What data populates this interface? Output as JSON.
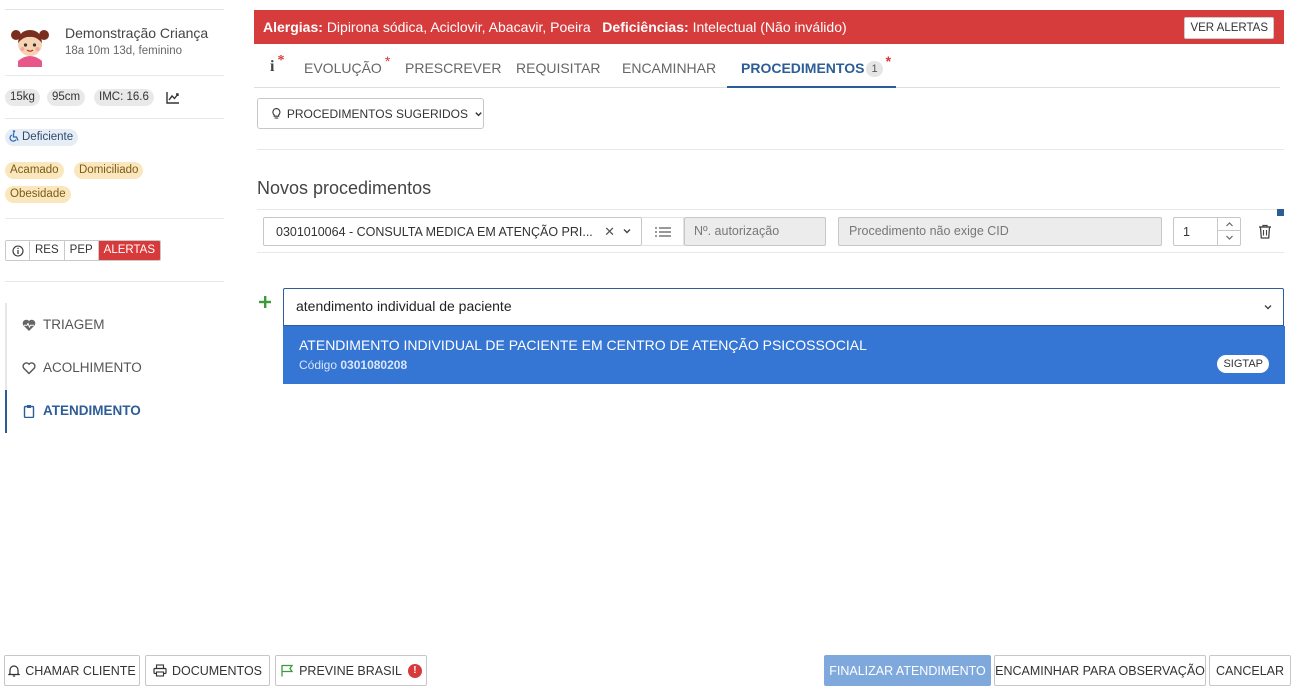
{
  "patient": {
    "name": "Demonstração Criança",
    "info": "18a 10m 13d, feminino"
  },
  "measures": {
    "weight": "15kg",
    "height": "95cm",
    "imc": "IMC: 16.6"
  },
  "condition_badge": "Deficiente",
  "tags": [
    "Acamado",
    "Domiciliado",
    "Obesidade"
  ],
  "record_buttons": {
    "res": "RES",
    "pep": "PEP",
    "alertas": "ALERTAS"
  },
  "nav": [
    {
      "label": "TRIAGEM",
      "icon": "heart-pulse-icon"
    },
    {
      "label": "ACOLHIMENTO",
      "icon": "heart-outline-icon"
    },
    {
      "label": "ATENDIMENTO",
      "icon": "clipboard-icon",
      "active": true
    }
  ],
  "alert_bar": {
    "allergies_label": "Alergias:",
    "allergies_value": "Dipirona sódica, Aciclovir, Abacavir, Poeira",
    "deficiencies_label": "Deficiências:",
    "deficiencies_value": "Intelectual (Não inválido)",
    "button": "VER ALERTAS",
    "color": "#d63c3c"
  },
  "tabs": {
    "info": "i",
    "evolucao": "EVOLUÇÃO",
    "prescrever": "PRESCREVER",
    "requisitar": "REQUISITAR",
    "encaminhar": "ENCAMINHAR",
    "procedimentos": "PROCEDIMENTOS",
    "procedimentos_count": "1",
    "required_mark": "*"
  },
  "suggested_button": "PROCEDIMENTOS SUGERIDOS",
  "section_title": "Novos procedimentos",
  "procedure_row": {
    "procedure": "0301010064 - CONSULTA MEDICA EM ATENÇÃO PRI...",
    "authorization_placeholder": "Nº. autorização",
    "cid_placeholder": "Procedimento não exige CID",
    "quantity": "1"
  },
  "search": {
    "value": "atendimento individual de paciente"
  },
  "dropdown_option": {
    "title": "ATENDIMENTO INDIVIDUAL DE PACIENTE EM CENTRO DE ATENÇÃO PSICOSSOCIAL",
    "code_label": "Código",
    "code": "0301080208",
    "source": "SIGTAP",
    "highlight_color": "#3575d3"
  },
  "footer": {
    "chamar_cliente": "CHAMAR CLIENTE",
    "documentos": "DOCUMENTOS",
    "previne_brasil": "PREVINE BRASIL",
    "previne_alert": "!",
    "finalizar": "FINALIZAR ATENDIMENTO",
    "encaminhar_obs": "ENCAMINHAR PARA OBSERVAÇÃO",
    "cancelar": "CANCELAR"
  },
  "colors": {
    "primary": "#2c5d97",
    "danger": "#d63a3a",
    "tag_yellow": "#fbe7bd"
  }
}
